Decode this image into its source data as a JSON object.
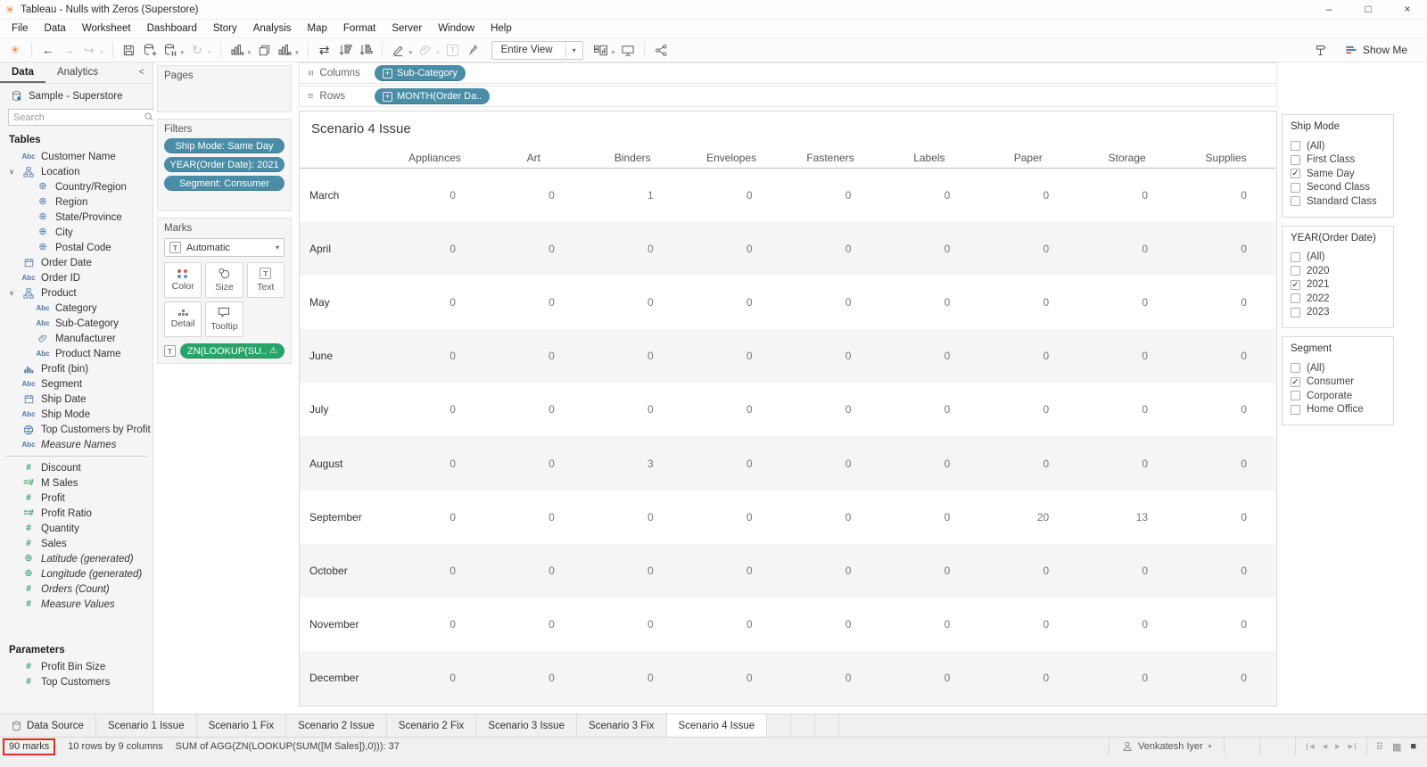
{
  "window": {
    "title": "Tableau - Nulls with Zeros (Superstore)",
    "menu": [
      "File",
      "Data",
      "Worksheet",
      "Dashboard",
      "Story",
      "Analysis",
      "Map",
      "Format",
      "Server",
      "Window",
      "Help"
    ]
  },
  "toolbar": {
    "fit_label": "Entire View",
    "show_me_label": "Show Me"
  },
  "icons": {
    "logo": "✳",
    "minimize": "–",
    "maximize": "□",
    "close": "×",
    "back_arrow": "←",
    "forward_arrow": "→",
    "redo": "↪",
    "refresh": "↻",
    "swap": "⇄",
    "caret": "▾",
    "chevron_down": "∨",
    "chevron_left": "<",
    "columns_glyph": "≡",
    "rows_glyph": "≡",
    "plus_box": "⊞",
    "warning": "⚠",
    "check": "✓",
    "globe": "⊕",
    "abc": "Abc",
    "hash": "#",
    "calc_hash": "=#",
    "braille_grid": "⠿",
    "grid": "▦",
    "square": "■",
    "prev": "◀",
    "next": "▶",
    "text_mark": "T"
  },
  "sidebar": {
    "tab_data": "Data",
    "tab_analytics": "Analytics",
    "datasource": "Sample - Superstore",
    "search_placeholder": "Search",
    "tables_label": "Tables",
    "fields": [
      {
        "icon": "abc-icon",
        "label": "Customer Name"
      },
      {
        "icon": "hierarchy-icon",
        "label": "Location",
        "expand": true
      },
      {
        "icon": "globe-icon",
        "label": "Country/Region",
        "indent": 1
      },
      {
        "icon": "globe-icon",
        "label": "Region",
        "indent": 1
      },
      {
        "icon": "globe-icon",
        "label": "State/Province",
        "indent": 1
      },
      {
        "icon": "globe-icon",
        "label": "City",
        "indent": 1
      },
      {
        "icon": "globe-icon",
        "label": "Postal Code",
        "indent": 1
      },
      {
        "icon": "calendar-icon",
        "label": "Order Date"
      },
      {
        "icon": "abc-icon",
        "label": "Order ID"
      },
      {
        "icon": "hierarchy-icon",
        "label": "Product",
        "expand": true
      },
      {
        "icon": "abc-icon",
        "label": "Category",
        "indent": 1
      },
      {
        "icon": "abc-icon",
        "label": "Sub-Category",
        "indent": 1
      },
      {
        "icon": "paperclip-icon",
        "label": "Manufacturer",
        "indent": 1
      },
      {
        "icon": "abc-icon",
        "label": "Product Name",
        "indent": 1
      },
      {
        "icon": "bin-icon",
        "label": "Profit (bin)"
      },
      {
        "icon": "abc-icon",
        "label": "Segment"
      },
      {
        "icon": "calendar-icon",
        "label": "Ship Date"
      },
      {
        "icon": "abc-icon",
        "label": "Ship Mode"
      },
      {
        "icon": "set-icon",
        "label": "Top Customers by Profit"
      },
      {
        "icon": "abc-icon",
        "label": "Measure Names",
        "italic": true
      },
      {
        "divider": true
      },
      {
        "icon": "hash-icon",
        "label": "Discount"
      },
      {
        "icon": "calc-hash-icon",
        "label": "M Sales"
      },
      {
        "icon": "hash-icon",
        "label": "Profit"
      },
      {
        "icon": "calc-hash-icon",
        "label": "Profit Ratio"
      },
      {
        "icon": "hash-icon",
        "label": "Quantity"
      },
      {
        "icon": "hash-icon",
        "label": "Sales"
      },
      {
        "icon": "globe-green-icon",
        "label": "Latitude (generated)",
        "italic": true
      },
      {
        "icon": "globe-green-icon",
        "label": "Longitude (generated)",
        "italic": true
      },
      {
        "icon": "hash-icon",
        "label": "Orders (Count)",
        "italic": true
      },
      {
        "icon": "hash-icon",
        "label": "Measure Values",
        "italic": true
      }
    ],
    "parameters_label": "Parameters",
    "parameters": [
      {
        "icon": "hash-icon",
        "label": "Profit Bin Size"
      },
      {
        "icon": "hash-icon",
        "label": "Top Customers"
      }
    ]
  },
  "cards": {
    "pages_label": "Pages",
    "filters_label": "Filters",
    "filter_pills": [
      "Ship Mode: Same Day",
      "YEAR(Order Date): 2021",
      "Segment: Consumer"
    ],
    "marks_label": "Marks",
    "mark_type": "Automatic",
    "mark_buttons": [
      {
        "icon": "color-icon",
        "label": "Color"
      },
      {
        "icon": "size-icon",
        "label": "Size"
      },
      {
        "icon": "text-icon",
        "label": "Text"
      },
      {
        "icon": "detail-icon",
        "label": "Detail"
      },
      {
        "icon": "tooltip-icon",
        "label": "Tooltip"
      }
    ],
    "text_pill": "ZN(LOOKUP(SU.."
  },
  "shelves": {
    "columns_label": "Columns",
    "columns_pills": [
      "Sub-Category"
    ],
    "rows_label": "Rows",
    "rows_pills": [
      "MONTH(Order Da.."
    ]
  },
  "sheet": {
    "title": "Scenario 4 Issue"
  },
  "chart_data": {
    "type": "table",
    "title": "Scenario 4 Issue",
    "columns": [
      "Appliances",
      "Art",
      "Binders",
      "Envelopes",
      "Fasteners",
      "Labels",
      "Paper",
      "Storage",
      "Supplies"
    ],
    "rows": [
      "March",
      "April",
      "May",
      "June",
      "July",
      "August",
      "September",
      "October",
      "November",
      "December"
    ],
    "values": [
      [
        0,
        0,
        1,
        0,
        0,
        0,
        0,
        0,
        0
      ],
      [
        0,
        0,
        0,
        0,
        0,
        0,
        0,
        0,
        0
      ],
      [
        0,
        0,
        0,
        0,
        0,
        0,
        0,
        0,
        0
      ],
      [
        0,
        0,
        0,
        0,
        0,
        0,
        0,
        0,
        0
      ],
      [
        0,
        0,
        0,
        0,
        0,
        0,
        0,
        0,
        0
      ],
      [
        0,
        0,
        3,
        0,
        0,
        0,
        0,
        0,
        0
      ],
      [
        0,
        0,
        0,
        0,
        0,
        0,
        20,
        13,
        0
      ],
      [
        0,
        0,
        0,
        0,
        0,
        0,
        0,
        0,
        0
      ],
      [
        0,
        0,
        0,
        0,
        0,
        0,
        0,
        0,
        0
      ],
      [
        0,
        0,
        0,
        0,
        0,
        0,
        0,
        0,
        0
      ]
    ]
  },
  "filter_panel": {
    "cards": [
      {
        "title": "Ship Mode",
        "options": [
          {
            "label": "(All)",
            "checked": false
          },
          {
            "label": "First Class",
            "checked": false
          },
          {
            "label": "Same Day",
            "checked": true
          },
          {
            "label": "Second Class",
            "checked": false
          },
          {
            "label": "Standard Class",
            "checked": false
          }
        ]
      },
      {
        "title": "YEAR(Order Date)",
        "options": [
          {
            "label": "(All)",
            "checked": false
          },
          {
            "label": "2020",
            "checked": false
          },
          {
            "label": "2021",
            "checked": true
          },
          {
            "label": "2022",
            "checked": false
          },
          {
            "label": "2023",
            "checked": false
          }
        ]
      },
      {
        "title": "Segment",
        "options": [
          {
            "label": "(All)",
            "checked": false
          },
          {
            "label": "Consumer",
            "checked": true
          },
          {
            "label": "Corporate",
            "checked": false
          },
          {
            "label": "Home Office",
            "checked": false
          }
        ]
      }
    ]
  },
  "tabs": {
    "datasource_label": "Data Source",
    "sheets": [
      "Scenario 1 Issue",
      "Scenario 1 Fix",
      "Scenario 2 Issue",
      "Scenario 2 Fix",
      "Scenario 3 Issue",
      "Scenario 3 Fix",
      "Scenario 4 Issue"
    ],
    "active": "Scenario 4 Issue"
  },
  "statusbar": {
    "marks": "90 marks",
    "size": "10 rows by 9 columns",
    "aggregation": "SUM of AGG(ZN(LOOKUP(SUM([M Sales]),0))): 37",
    "user": "Venkatesh Iyer"
  },
  "colors": {
    "pill_teal": "#4A8DA6",
    "pill_green": "#26A469",
    "annotation_red": "#D93025",
    "field_blue": "#4E79A7",
    "field_green": "#2E9E63",
    "logo_orange": "#E8762D"
  }
}
